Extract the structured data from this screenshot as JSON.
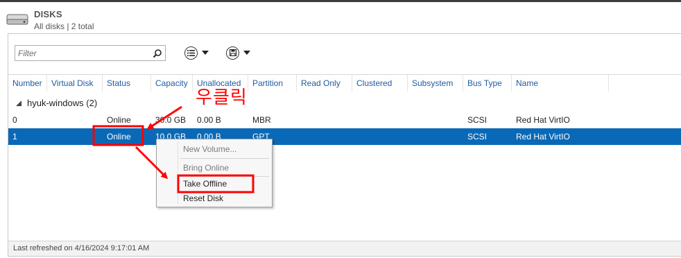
{
  "header": {
    "title": "DISKS",
    "subtitle": "All disks | 2 total"
  },
  "toolbar": {
    "filter_placeholder": "Filter",
    "icons": [
      "search-icon",
      "list-options-icon",
      "save-icon",
      "chevron-down-icon"
    ]
  },
  "columns": [
    "Number",
    "Virtual Disk",
    "Status",
    "Capacity",
    "Unallocated",
    "Partition",
    "Read Only",
    "Clustered",
    "Subsystem",
    "Bus Type",
    "Name"
  ],
  "group": {
    "label": "hyuk-windows (2)"
  },
  "rows": [
    {
      "number": "0",
      "virtual_disk": "",
      "status": "Online",
      "capacity": "30.0 GB",
      "unallocated": "0.00 B",
      "partition": "MBR",
      "read_only": "",
      "clustered": "",
      "subsystem": "",
      "bus_type": "SCSI",
      "name": "Red Hat VirtIO"
    },
    {
      "number": "1",
      "virtual_disk": "",
      "status": "Online",
      "capacity": "10.0 GB",
      "unallocated": "0.00 B",
      "partition": "GPT",
      "read_only": "",
      "clustered": "",
      "subsystem": "",
      "bus_type": "SCSI",
      "name": "Red Hat VirtIO"
    }
  ],
  "context_menu": {
    "items": [
      {
        "label": "New Volume...",
        "enabled": false
      },
      {
        "label": "Bring Online",
        "enabled": false
      },
      {
        "label": "Take Offline",
        "enabled": true
      },
      {
        "label": "Reset Disk",
        "enabled": true
      }
    ]
  },
  "footer": {
    "status": "Last refreshed on 4/16/2024 9:17:01 AM"
  },
  "annotation": {
    "text": "우클릭",
    "color": "#ff0000"
  },
  "colors": {
    "selection": "#0a69b6",
    "header_text": "#1f5a9e",
    "annotation": "#ff0000"
  }
}
